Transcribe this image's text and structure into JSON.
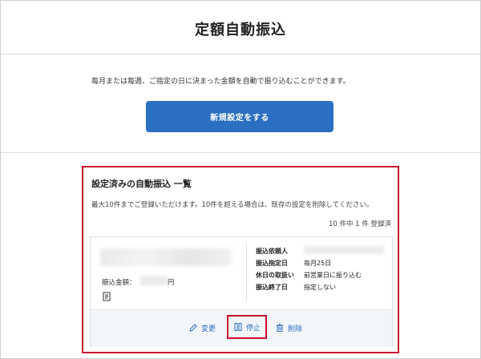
{
  "header": {
    "title": "定額自動振込"
  },
  "intro": {
    "description": "毎月または毎週、ご指定の日に決まった金額を自動で振り込むことができます。",
    "new_button_label": "新規設定をする"
  },
  "registered": {
    "title": "設定済みの自動振込 一覧",
    "note": "最大10件までご登録いただけます。10件を超える場合は、既存の設定を削除してください。",
    "count_text": "10 件中 1 件 登録済"
  },
  "card": {
    "amount_label": "振込金額：",
    "amount_unit": "円",
    "details": [
      {
        "label": "振込依頼人",
        "value": ""
      },
      {
        "label": "振込指定日",
        "value": "毎月25日"
      },
      {
        "label": "休日の取扱い",
        "value": "前営業日に振り込む"
      },
      {
        "label": "振込終了日",
        "value": "指定しない"
      }
    ],
    "actions": {
      "edit_label": "変更",
      "stop_label": "停止",
      "delete_label": "削除"
    }
  },
  "colors": {
    "primary": "#2a6fc1",
    "highlight": "#c8102e",
    "action_bar": "#f3f6f9"
  },
  "icons": {
    "memo": "memo-icon",
    "edit": "pencil-icon",
    "stop": "pause-icon",
    "delete": "trash-icon"
  }
}
